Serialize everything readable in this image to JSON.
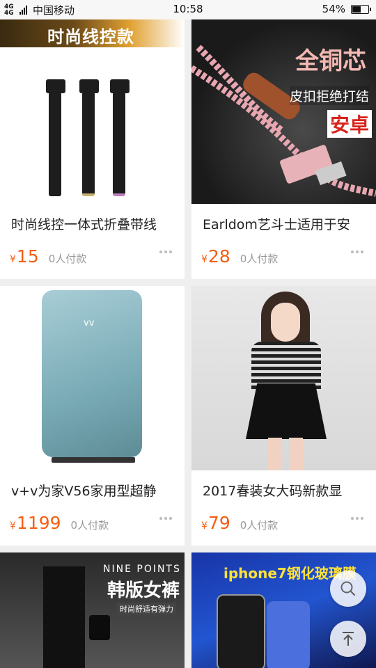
{
  "status_bar": {
    "network": "4G 4G",
    "carrier": "中国移动",
    "time": "10:58",
    "battery": "54%",
    "battery_level": 0.54
  },
  "products": [
    {
      "banner": "时尚线控款",
      "title": "时尚线控一体式折叠带线",
      "currency": "¥",
      "price": "15",
      "sold": "0人付款"
    },
    {
      "banner_big": "全铜芯",
      "banner_mid": "皮扣拒绝打结",
      "banner_red": "安卓",
      "title": "Earldom艺斗士适用于安",
      "currency": "¥",
      "price": "28",
      "sold": "0人付款"
    },
    {
      "logo": "vv",
      "title": "v+v为家V56家用型超静",
      "currency": "¥",
      "price": "1199",
      "sold": "0人付款"
    },
    {
      "title": "2017春装女大码新款显",
      "currency": "¥",
      "price": "79",
      "sold": "0人付款"
    },
    {
      "banner_en": "NINE POINTS",
      "banner": "韩版女裤",
      "banner_sub": "时尚舒适有弹力"
    },
    {
      "banner": "iphone7钢化玻璃膜"
    }
  ],
  "colors": {
    "price": "#f55e12",
    "sold": "#999999",
    "background": "#efefef"
  },
  "icons": [
    "search-icon",
    "back-to-top-icon",
    "more-icon"
  ]
}
